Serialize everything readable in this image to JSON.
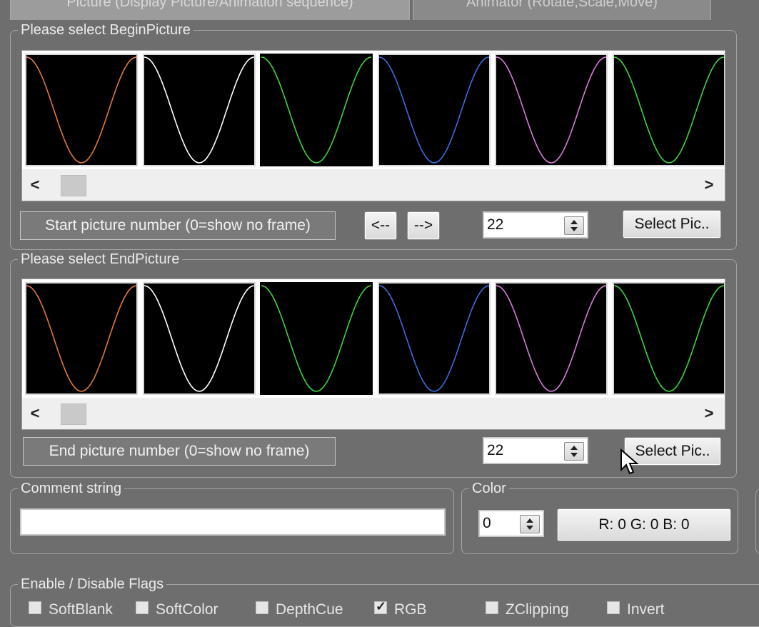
{
  "tabs": [
    {
      "label": "Picture (Display Picture/Animation sequence)"
    },
    {
      "label": "Animator (Rotate,Scale,Move)"
    }
  ],
  "begin_group": {
    "legend": "Please select BeginPicture",
    "thumbnails": [
      {
        "color": "#e07a38"
      },
      {
        "color": "#ffffff"
      },
      {
        "color": "#3ed43e"
      },
      {
        "color": "#3a6ee0"
      },
      {
        "color": "#d87ad8"
      },
      {
        "color": "#3ed43e"
      }
    ],
    "selected_index": 2,
    "scroll_left": "<",
    "scroll_right": ">",
    "number_label": "Start picture number (0=show no frame)",
    "prev_button": "<--",
    "next_button": "-->",
    "number_value": "22",
    "select_button": "Select Pic.."
  },
  "end_group": {
    "legend": "Please select EndPicture",
    "thumbnails": [
      {
        "color": "#e07a38"
      },
      {
        "color": "#ffffff"
      },
      {
        "color": "#3ed43e"
      },
      {
        "color": "#3a6ee0"
      },
      {
        "color": "#d87ad8"
      },
      {
        "color": "#3ed43e"
      }
    ],
    "selected_index": 2,
    "scroll_left": "<",
    "scroll_right": ">",
    "number_label": "End picture number (0=show no frame)",
    "number_value": "22",
    "select_button": "Select Pic.."
  },
  "comment_group": {
    "legend": "Comment string",
    "value": ""
  },
  "color_group": {
    "legend": "Color",
    "index_value": "0",
    "rgb_button": "R: 0 G: 0 B: 0"
  },
  "flags_group": {
    "legend": "Enable / Disable Flags",
    "flags": [
      {
        "label": "SoftBlank",
        "checked": false
      },
      {
        "label": "SoftColor",
        "checked": false
      },
      {
        "label": "DepthCue",
        "checked": false
      },
      {
        "label": "RGB",
        "checked": true
      },
      {
        "label": "ZClipping",
        "checked": false
      },
      {
        "label": "Invert",
        "checked": false
      }
    ]
  },
  "icons": {
    "cursor": "mouse-pointer-icon",
    "spin": "spin-arrows-icon"
  }
}
